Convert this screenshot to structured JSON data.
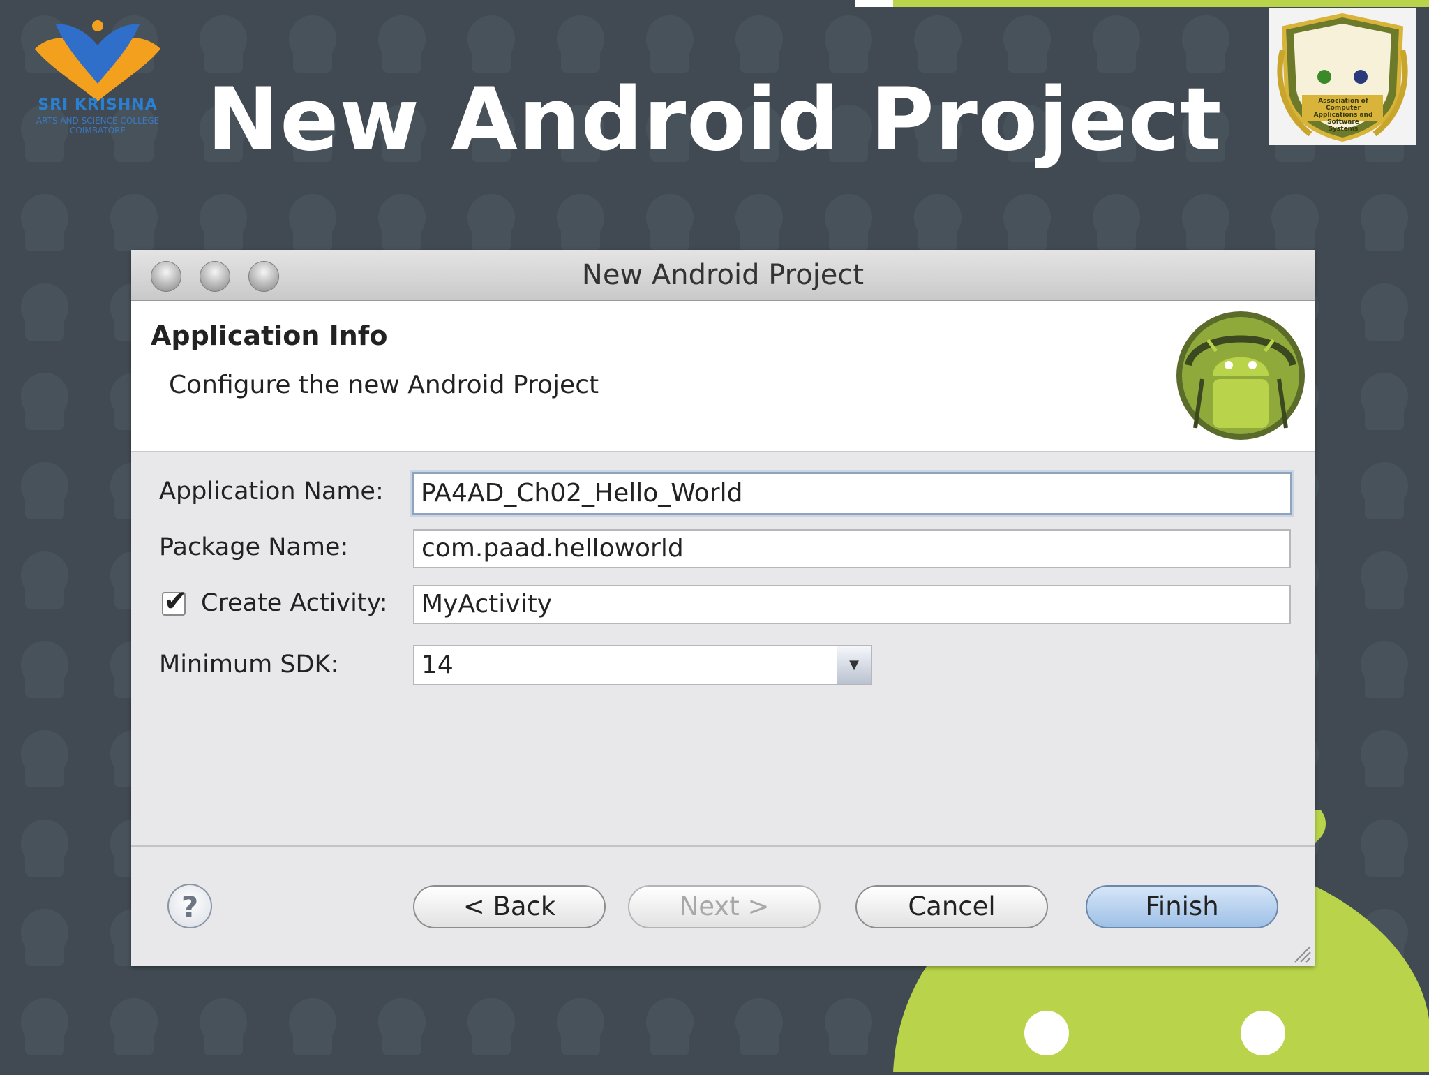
{
  "slide": {
    "title": "New Android Project",
    "college_logo_name": "SRI KRISHNA",
    "college_logo_sub": "ARTS AND SCIENCE COLLEGE COIMBATORE",
    "badge_text": "Association of Computer Applications and Software Systems"
  },
  "window": {
    "title": "New Android Project",
    "section_title": "Application Info",
    "section_desc": "Configure the new Android Project"
  },
  "form": {
    "app_name_label": "Application Name:",
    "app_name_value": "PA4AD_Ch02_Hello_World",
    "package_label": "Package Name:",
    "package_value": "com.paad.helloworld",
    "create_activity_label": "Create Activity:",
    "create_activity_checked": true,
    "create_activity_value": "MyActivity",
    "min_sdk_label": "Minimum SDK:",
    "min_sdk_value": "14"
  },
  "buttons": {
    "help": "?",
    "back": "< Back",
    "next": "Next >",
    "cancel": "Cancel",
    "finish": "Finish"
  },
  "colors": {
    "slide_background": "#414a52",
    "android_green": "#b9d44a",
    "default_button": "#9ec0e6"
  },
  "icons": [
    "window-close-icon",
    "window-minimize-icon",
    "window-zoom-icon",
    "android-icon",
    "help-icon",
    "checkmark-icon",
    "chevron-down-icon",
    "resize-grip-icon"
  ]
}
